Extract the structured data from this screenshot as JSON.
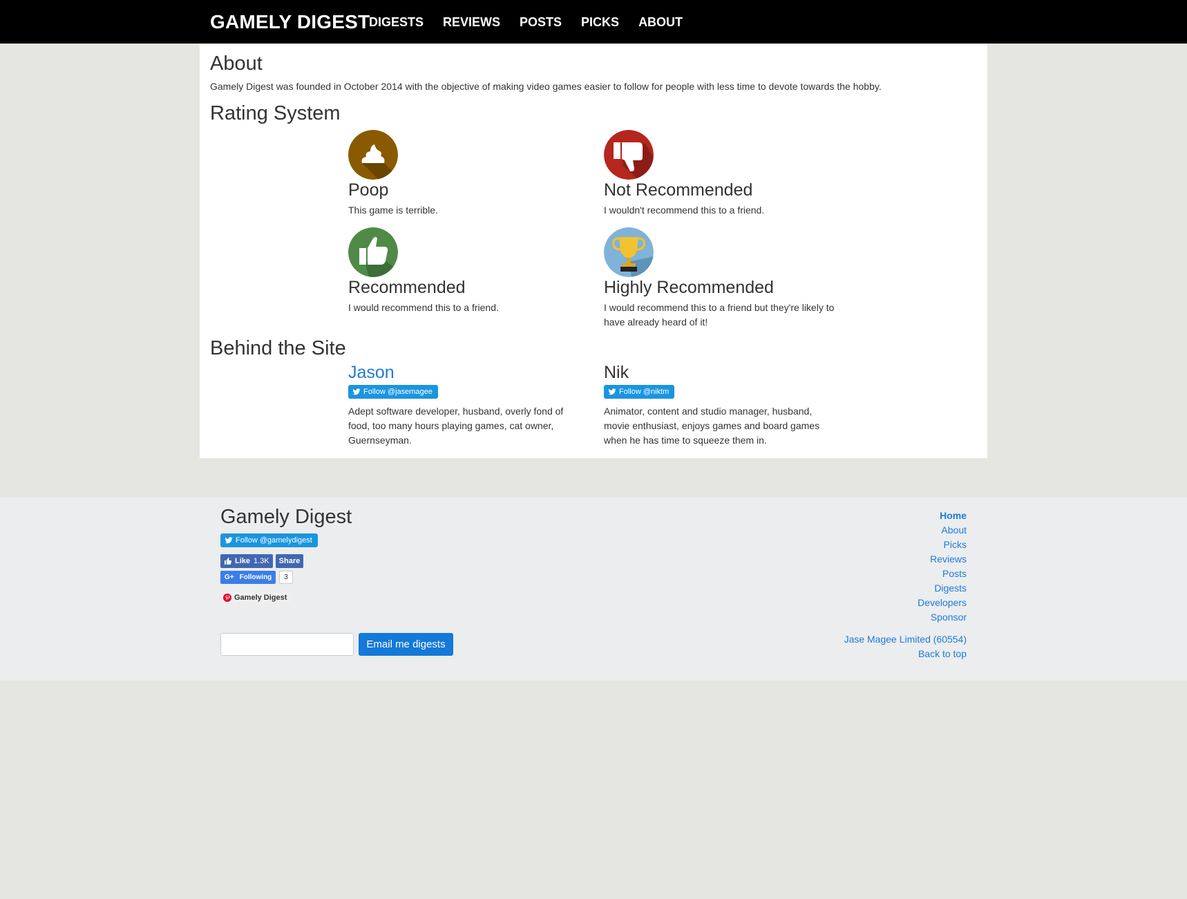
{
  "nav": {
    "brand": "GAMELY DIGEST",
    "items": [
      "DIGESTS",
      "REVIEWS",
      "POSTS",
      "PICKS",
      "ABOUT"
    ]
  },
  "about": {
    "heading": "About",
    "text": "Gamely Digest was founded in October 2014 with the objective of making video games easier to follow for people with less time to devote towards the hobby."
  },
  "rating_system": {
    "heading": "Rating System",
    "ratings": [
      {
        "icon": "poop-icon",
        "color": "#8a5a00",
        "title": "Poop",
        "desc": "This game is terrible."
      },
      {
        "icon": "thumbs-down-icon",
        "color": "#b5261e",
        "title": "Not Recommended",
        "desc": "I wouldn't recommend this to a friend."
      },
      {
        "icon": "thumbs-up-icon",
        "color": "#4f8a47",
        "title": "Recommended",
        "desc": "I would recommend this to a friend."
      },
      {
        "icon": "trophy-icon",
        "color": "#7fb3d8",
        "title": "Highly Recommended",
        "desc": "I would recommend this to a friend but they're likely to have already heard of it!"
      }
    ]
  },
  "behind": {
    "heading": "Behind the Site",
    "people": [
      {
        "name": "Jason",
        "follow": "Follow @jasemagee",
        "bio": "Adept software developer, husband, overly fond of food, too many hours playing games, cat owner, Guernseyman."
      },
      {
        "name": "Nik",
        "follow": "Follow @niktm",
        "bio": "Animator, content and studio manager, husband, movie enthusiast, enjoys games and board games when he has time to squeeze them in."
      }
    ]
  },
  "footer": {
    "title": "Gamely Digest",
    "twitter_follow": "Follow @gamelydigest",
    "fb_like": "Like",
    "fb_like_count": "1.3K",
    "fb_share": "Share",
    "gplus_label": "Following",
    "gplus_count": "3",
    "pinterest_label": "Gamely Digest",
    "email_button": "Email me digests",
    "email_placeholder": "",
    "links": [
      "Home",
      "About",
      "Picks",
      "Reviews",
      "Posts",
      "Digests",
      "Developers",
      "Sponsor"
    ],
    "company": "Jase Magee Limited (60554)",
    "back_to_top": "Back to top"
  },
  "colors": {
    "navbar": "#000000",
    "page_bg": "#e6e6e1",
    "footer_bg": "#ebedef",
    "link": "#1e7bd6",
    "twitter": "#1b95e0",
    "facebook": "#4267b2",
    "button": "#1479d8"
  }
}
